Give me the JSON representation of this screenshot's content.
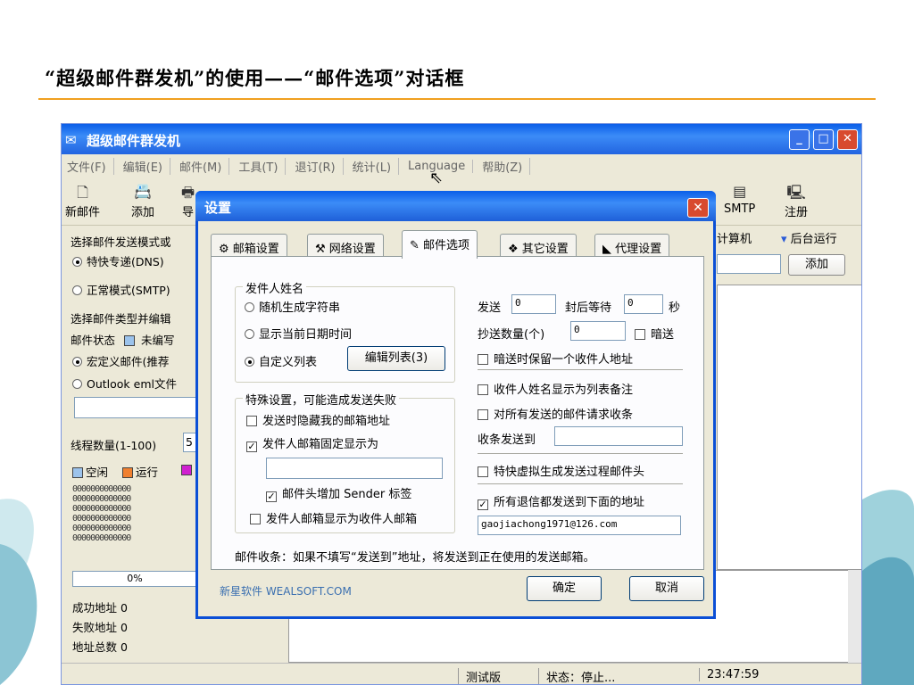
{
  "slide": {
    "title": "“超级邮件群发机”的使用——“邮件选项”对话框"
  },
  "app": {
    "title": "超级邮件群发机",
    "menu": [
      "文件(F)",
      "编辑(E)",
      "邮件(M)",
      "工具(T)",
      "退订(R)",
      "统计(L)",
      "Language",
      "帮助(Z)"
    ],
    "toolbar": {
      "new_mail": "新邮件",
      "add": "添加",
      "export_partial": "导",
      "smtp": "SMTP",
      "register": "注册"
    },
    "left": {
      "mode_heading": "选择邮件发送模式或",
      "mode_express": "特快专递(DNS)",
      "mode_normal": "正常模式(SMTP)",
      "type_heading": "选择邮件类型并编辑",
      "status_label": "邮件状态",
      "status_value": "未编写",
      "macro_mail": "宏定义邮件(推荐",
      "outlook_file": "Outlook eml文件",
      "threads_label": "线程数量(1-100)",
      "threads_value": "5",
      "legend_idle": "空闲",
      "legend_running": "运行",
      "cells_row": "0000000000000",
      "progress": "0%",
      "success": "成功地址 0",
      "failed": "失败地址 0",
      "total": "地址总数 0"
    },
    "right": {
      "computer_partial": "计算机",
      "background_run": "后台运行",
      "add_button": "添加"
    },
    "status": {
      "version": "测试版",
      "state": "状态：停止...",
      "time": "23:47:59"
    }
  },
  "dialog": {
    "title": "设置",
    "tabs": [
      "邮箱设置",
      "网络设置",
      "邮件选项",
      "其它设置",
      "代理设置"
    ],
    "active_tab": "邮件选项",
    "sender_group": {
      "label": "发件人姓名",
      "random": "随机生成字符串",
      "date": "显示当前日期时间",
      "custom": "自定义列表",
      "edit_list_button": "编辑列表(3)"
    },
    "special_group": {
      "label": "特殊设置，可能造成发送失败",
      "hide_mailbox": "发送时隐藏我的邮箱地址",
      "fixed_sender": "发件人邮箱固定显示为",
      "fixed_sender_value": "",
      "add_sender_tag": "邮件头增加 Sender 标签",
      "sender_as_recipient": "发件人邮箱显示为收件人邮箱"
    },
    "right_col": {
      "send_label": "发送",
      "send_value": "0",
      "wait_label": "封后等待",
      "wait_value": "0",
      "seconds": "秒",
      "cc_label": "抄送数量(个)",
      "cc_value": "0",
      "bcc": "暗送",
      "bcc_keep_one": "暗送时保留一个收件人地址",
      "name_as_note": "收件人姓名显示为列表备注",
      "receipt": "对所有发送的邮件请求收条",
      "receipt_to_label": "收条发送到",
      "receipt_to_value": "",
      "fake_header": "特快虚拟生成发送过程邮件头",
      "bounce_to": "所有退信都发送到下面的地址",
      "bounce_address": "gaojiachong1971@126.com"
    },
    "note": "邮件收条：如果不填写“发送到”地址，将发送到正在使用的发送邮箱。",
    "brand": "新星软件 WEALSOFT.COM",
    "ok_button": "确定",
    "cancel_button": "取消"
  }
}
